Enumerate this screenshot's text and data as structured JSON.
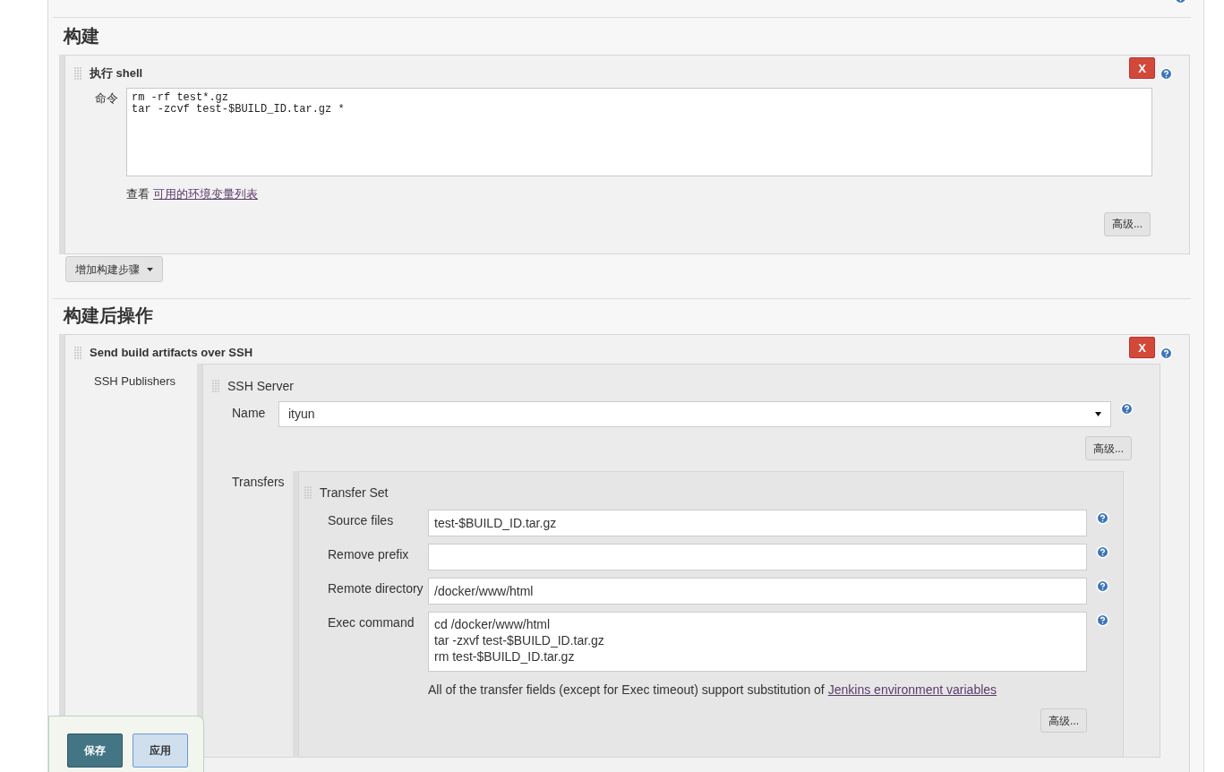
{
  "build": {
    "title": "构建",
    "step": {
      "title": "执行 shell",
      "close_button": "X",
      "command_label": "命令",
      "command_lines": [
        "rm -rf test*.gz",
        "tar -zcvf test-$BUILD_ID.tar.gz *"
      ],
      "hint": {
        "text": "查看",
        "link": "可用的环境变量列表"
      },
      "advanced_button": "高级..."
    },
    "add_step_button": "增加构建步骤"
  },
  "post_build": {
    "title": "构建后操作",
    "step": {
      "title": "Send build artifacts over SSH",
      "close_button": "X",
      "publishers_label": "SSH Publishers",
      "server": {
        "title": "SSH Server",
        "name_label": "Name",
        "name_value": "ityun",
        "advanced_button": "高级...",
        "transfers_label": "Transfers",
        "transfer_set": {
          "title": "Transfer Set",
          "fields": [
            {
              "label": "Source files",
              "kind": "input",
              "value": "test-$BUILD_ID.tar.gz"
            },
            {
              "label": "Remove prefix",
              "kind": "input"
            },
            {
              "label": "Remote directory",
              "kind": "input",
              "value": "/docker/www/html"
            },
            {
              "label": "Exec command",
              "kind": "textarea",
              "lines": [
                "cd /docker/www/html",
                "tar -zxvf test-$BUILD_ID.tar.gz",
                "rm test-$BUILD_ID.tar.gz"
              ]
            }
          ],
          "note": {
            "text": "All of the transfer fields (except for Exec timeout) support substitution of",
            "link": "Jenkins environment variables"
          },
          "advanced_button": "高级..."
        }
      }
    }
  },
  "footer": {
    "save_button": "保存",
    "apply_button": "应用"
  }
}
